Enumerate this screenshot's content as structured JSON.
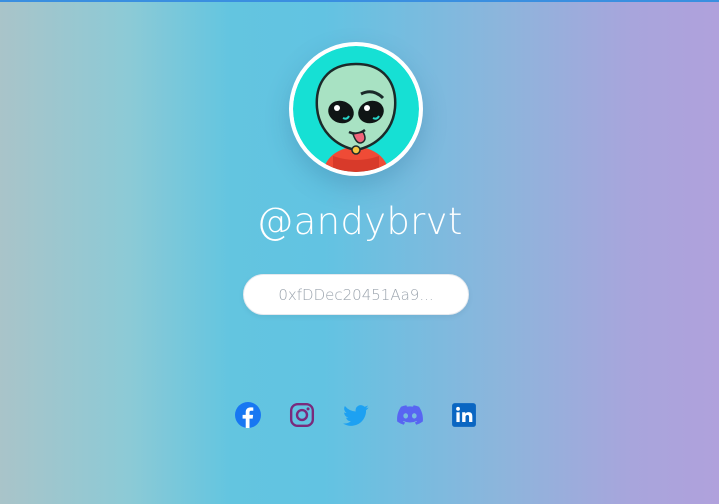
{
  "profile": {
    "username": "@andybrvt",
    "avatar_icon": "alien-avatar-icon"
  },
  "wallet": {
    "address_display": "0xfDDec20451Aa9..."
  },
  "social": [
    {
      "name": "facebook-icon",
      "color": "#1877f2"
    },
    {
      "name": "instagram-icon",
      "color": "#7a2a7c"
    },
    {
      "name": "twitter-icon",
      "color": "#1da1f2"
    },
    {
      "name": "discord-icon",
      "color": "#5865f2"
    },
    {
      "name": "linkedin-icon",
      "color": "#0a66c2"
    }
  ],
  "colors": {
    "accent_line": "#3a8fe0",
    "text": "#ffffff",
    "wallet_text": "#9aa3ad"
  }
}
